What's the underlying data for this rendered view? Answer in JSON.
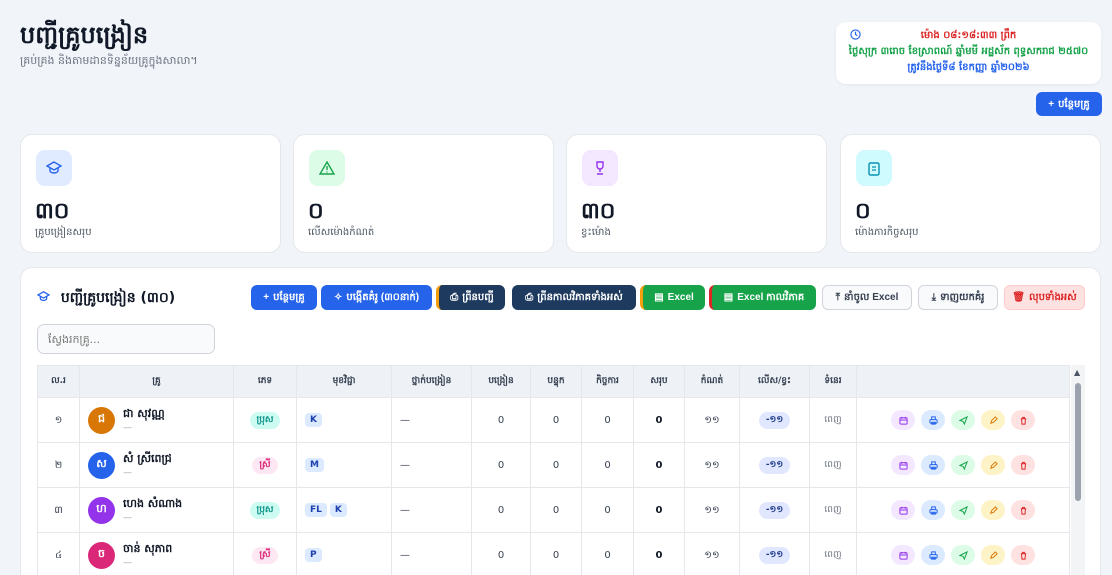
{
  "header": {
    "title": "បញ្ជីគ្រូបង្រៀន",
    "subtitle": "គ្រប់គ្រង និងតាមដានទិន្នន័យគ្រូក្នុងសាលា។"
  },
  "clock": {
    "icon": "clock-icon",
    "time": "ម៉ោង ០៨:១៨:៣៣ ព្រឹក",
    "lunar_date": "ថ្ងៃសុក្រ ៣រោច ខែស្រាពណ៍ ឆ្នាំមមី អដ្ឋស័ក ពុទ្ធសករាជ ២៥៧០",
    "solar_date": "ត្រូវនឹងថ្ងៃទី៨ ខែកញ្ញា ឆ្នាំ២០២៦"
  },
  "top_add_button": "បន្ថែមគ្រូ",
  "stats": [
    {
      "icon": "graduation-cap-icon",
      "value": "៣០",
      "label": "គ្រូបង្រៀនសរុប",
      "color": "#2563eb",
      "bg": "#e0ebff"
    },
    {
      "icon": "warning-icon",
      "value": "០",
      "label": "លើសម៉ោងកំណត់",
      "color": "#16a34a",
      "bg": "#dcfce7"
    },
    {
      "icon": "trophy-icon",
      "value": "៣០",
      "label": "ខ្វះម៉ោង",
      "color": "#9333ea",
      "bg": "#f3e8ff"
    },
    {
      "icon": "clipboard-icon",
      "value": "០",
      "label": "ម៉ោងភារកិច្ចសរុប",
      "color": "#0891b2",
      "bg": "#cffafe"
    }
  ],
  "panel": {
    "title": "បញ្ជីគ្រូបង្រៀន (៣០)",
    "buttons": {
      "add": "បន្ថែមគ្រូ",
      "generate": "បង្កើតគំរូ (៣០នាក់)",
      "print_list": "ព្រីនបញ្ជី",
      "print_all": "ព្រីនកាលវិភាគទាំងអស់",
      "excel": "Excel",
      "excel_schedule": "Excel កាលវិភាគ",
      "import_excel": "នាំចូល Excel",
      "download_template": "ទាញយកគំរូ",
      "delete_all": "លុបទាំងអស់"
    },
    "search_placeholder": "ស្វែងរកគ្រូ..."
  },
  "table": {
    "columns": [
      "ល.រ",
      "គ្រូ",
      "ភេទ",
      "មុខវិជ្ជា",
      "ថ្នាក់បង្រៀន",
      "បង្រៀន",
      "បន្ទុក",
      "កិច្ចការ",
      "សរុប",
      "កំណត់",
      "លើស/ខ្វះ",
      "ទំនេរ"
    ],
    "rows": [
      {
        "no": "១",
        "initial": "ជ",
        "name": "ជា សុវណ្ណ",
        "sub": "—",
        "avatar_color": "#d97706",
        "gender": "ប្រុស",
        "gender_type": "m",
        "subjects": [
          "K"
        ],
        "classes": "—",
        "teach": "0",
        "load": "0",
        "tasks": "0",
        "total": "0",
        "limit": "១១",
        "diff": "-១១",
        "free": "ពេញ"
      },
      {
        "no": "២",
        "initial": "ស",
        "name": "សំ ស្រីពេជ្រ",
        "sub": "—",
        "avatar_color": "#2563eb",
        "gender": "ស្រី",
        "gender_type": "f",
        "subjects": [
          "M"
        ],
        "classes": "—",
        "teach": "0",
        "load": "0",
        "tasks": "0",
        "total": "0",
        "limit": "១១",
        "diff": "-១១",
        "free": "ពេញ"
      },
      {
        "no": "៣",
        "initial": "ហ",
        "name": "ហេង សំណាង",
        "sub": "—",
        "avatar_color": "#9333ea",
        "gender": "ប្រុស",
        "gender_type": "m",
        "subjects": [
          "FL",
          "K"
        ],
        "classes": "—",
        "teach": "0",
        "load": "0",
        "tasks": "0",
        "total": "0",
        "limit": "១១",
        "diff": "-១១",
        "free": "ពេញ"
      },
      {
        "no": "៤",
        "initial": "ច",
        "name": "ចាន់ សុភាព",
        "sub": "—",
        "avatar_color": "#db2777",
        "gender": "ស្រី",
        "gender_type": "f",
        "subjects": [
          "P"
        ],
        "classes": "—",
        "teach": "0",
        "load": "0",
        "tasks": "0",
        "total": "0",
        "limit": "១១",
        "diff": "-១១",
        "free": "ពេញ"
      }
    ],
    "action_icons": [
      "calendar-icon",
      "printer-icon",
      "send-icon",
      "edit-icon",
      "trash-icon"
    ]
  }
}
